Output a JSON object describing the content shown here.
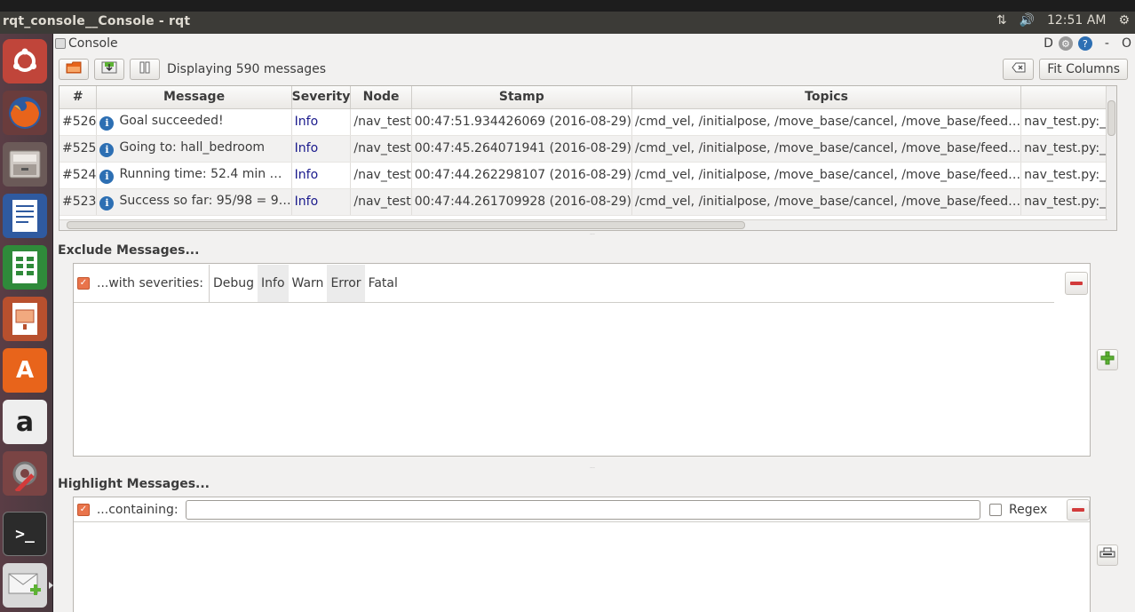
{
  "window": {
    "title": "rqt_console__Console - rqt"
  },
  "tray": {
    "time": "12:51 AM"
  },
  "console": {
    "title": "Console",
    "right_label_d": "D",
    "right_label_dash": "-",
    "right_label_o": "O"
  },
  "toolbar": {
    "display_count": "Displaying 590 messages",
    "fit_columns": "Fit Columns"
  },
  "table": {
    "headers": [
      "#",
      "Message",
      "Severity",
      "Node",
      "Stamp",
      "Topics",
      ""
    ],
    "rows": [
      {
        "num": "#526",
        "message": "Goal succeeded!",
        "severity": "Info",
        "node": "/nav_test",
        "stamp": "00:47:51.934426069 (2016-08-29)",
        "topics": "/cmd_vel, /initialpose, /move_base/cancel, /move_base/feed…",
        "location": "nav_test.py:__init"
      },
      {
        "num": "#525",
        "message": "Going to: hall_bedroom",
        "severity": "Info",
        "node": "/nav_test",
        "stamp": "00:47:45.264071941 (2016-08-29)",
        "topics": "/cmd_vel, /initialpose, /move_base/cancel, /move_base/feed…",
        "location": "nav_test.py:__init"
      },
      {
        "num": "#524",
        "message": "Running time: 52.4 min …",
        "severity": "Info",
        "node": "/nav_test",
        "stamp": "00:47:44.262298107 (2016-08-29)",
        "topics": "/cmd_vel, /initialpose, /move_base/cancel, /move_base/feed…",
        "location": "nav_test.py:__init"
      },
      {
        "num": "#523",
        "message": "Success so far: 95/98 = 9…",
        "severity": "Info",
        "node": "/nav_test",
        "stamp": "00:47:44.261709928 (2016-08-29)",
        "topics": "/cmd_vel, /initialpose, /move_base/cancel, /move_base/feed…",
        "location": "nav_test.py:__init"
      }
    ]
  },
  "exclude": {
    "title": "Exclude Messages...",
    "label": "...with severities:",
    "severities": [
      "Debug",
      "Info",
      "Warn",
      "Error",
      "Fatal"
    ]
  },
  "highlight": {
    "title": "Highlight Messages...",
    "label": "...containing:",
    "input_value": "",
    "regex_label": "Regex"
  },
  "colors": {
    "accent": "#e9744b",
    "info_blue": "#2d6fb3",
    "remove_red": "#d23b3b",
    "add_green": "#5db234"
  }
}
